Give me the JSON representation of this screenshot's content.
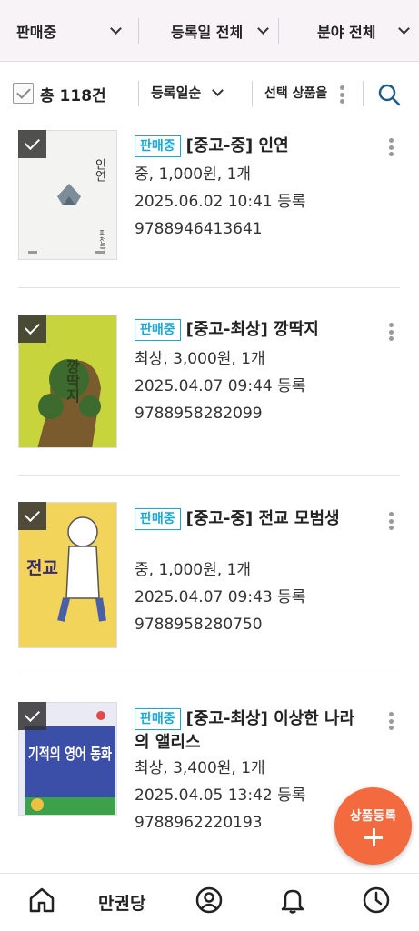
{
  "filters": {
    "status": "판매중",
    "date": "등록일 전체",
    "category": "분야 전체"
  },
  "toolbar": {
    "total_label": "총 118건",
    "sort_label": "등록일순",
    "select_action": "선택 상품을"
  },
  "items": [
    {
      "badge": "판매중",
      "title": "[중고-중] 인연",
      "condition_line": "중, 1,000원, 1개",
      "registered": "2025.06.02 10:41 등록",
      "isbn": "9788946413641",
      "cover": {
        "title": "인연",
        "author": "피천득"
      }
    },
    {
      "badge": "판매중",
      "title": "[중고-최상] 깡딱지",
      "condition_line": "최상, 3,000원, 1개",
      "registered": "2025.04.07 09:44 등록",
      "isbn": "9788958282099",
      "cover": {
        "title": "깡딱지"
      }
    },
    {
      "badge": "판매중",
      "title": "[중고-중] 전교 모범생",
      "condition_line": "중, 1,000원, 1개",
      "registered": "2025.04.07 09:43 등록",
      "isbn": "9788958280750",
      "cover": {
        "title": "전교 모범생"
      }
    },
    {
      "badge": "판매중",
      "title": "[중고-최상] 이상한 나라의 앨리스",
      "condition_line": "최상, 3,400원, 1개",
      "registered": "2025.04.05 13:42 등록",
      "isbn": "9788962220193",
      "cover": {
        "title": "기적의 영어 동화"
      }
    }
  ],
  "fab": {
    "label": "상품등록"
  },
  "bottom_nav": {
    "store_label": "만권당",
    "icons": [
      "home-icon",
      "profile-icon",
      "bell-icon",
      "clock-icon"
    ]
  },
  "colors": {
    "accent": "#1aa7d4",
    "fab": "#f26a3d",
    "filter_bg": "#f7f3f7"
  }
}
